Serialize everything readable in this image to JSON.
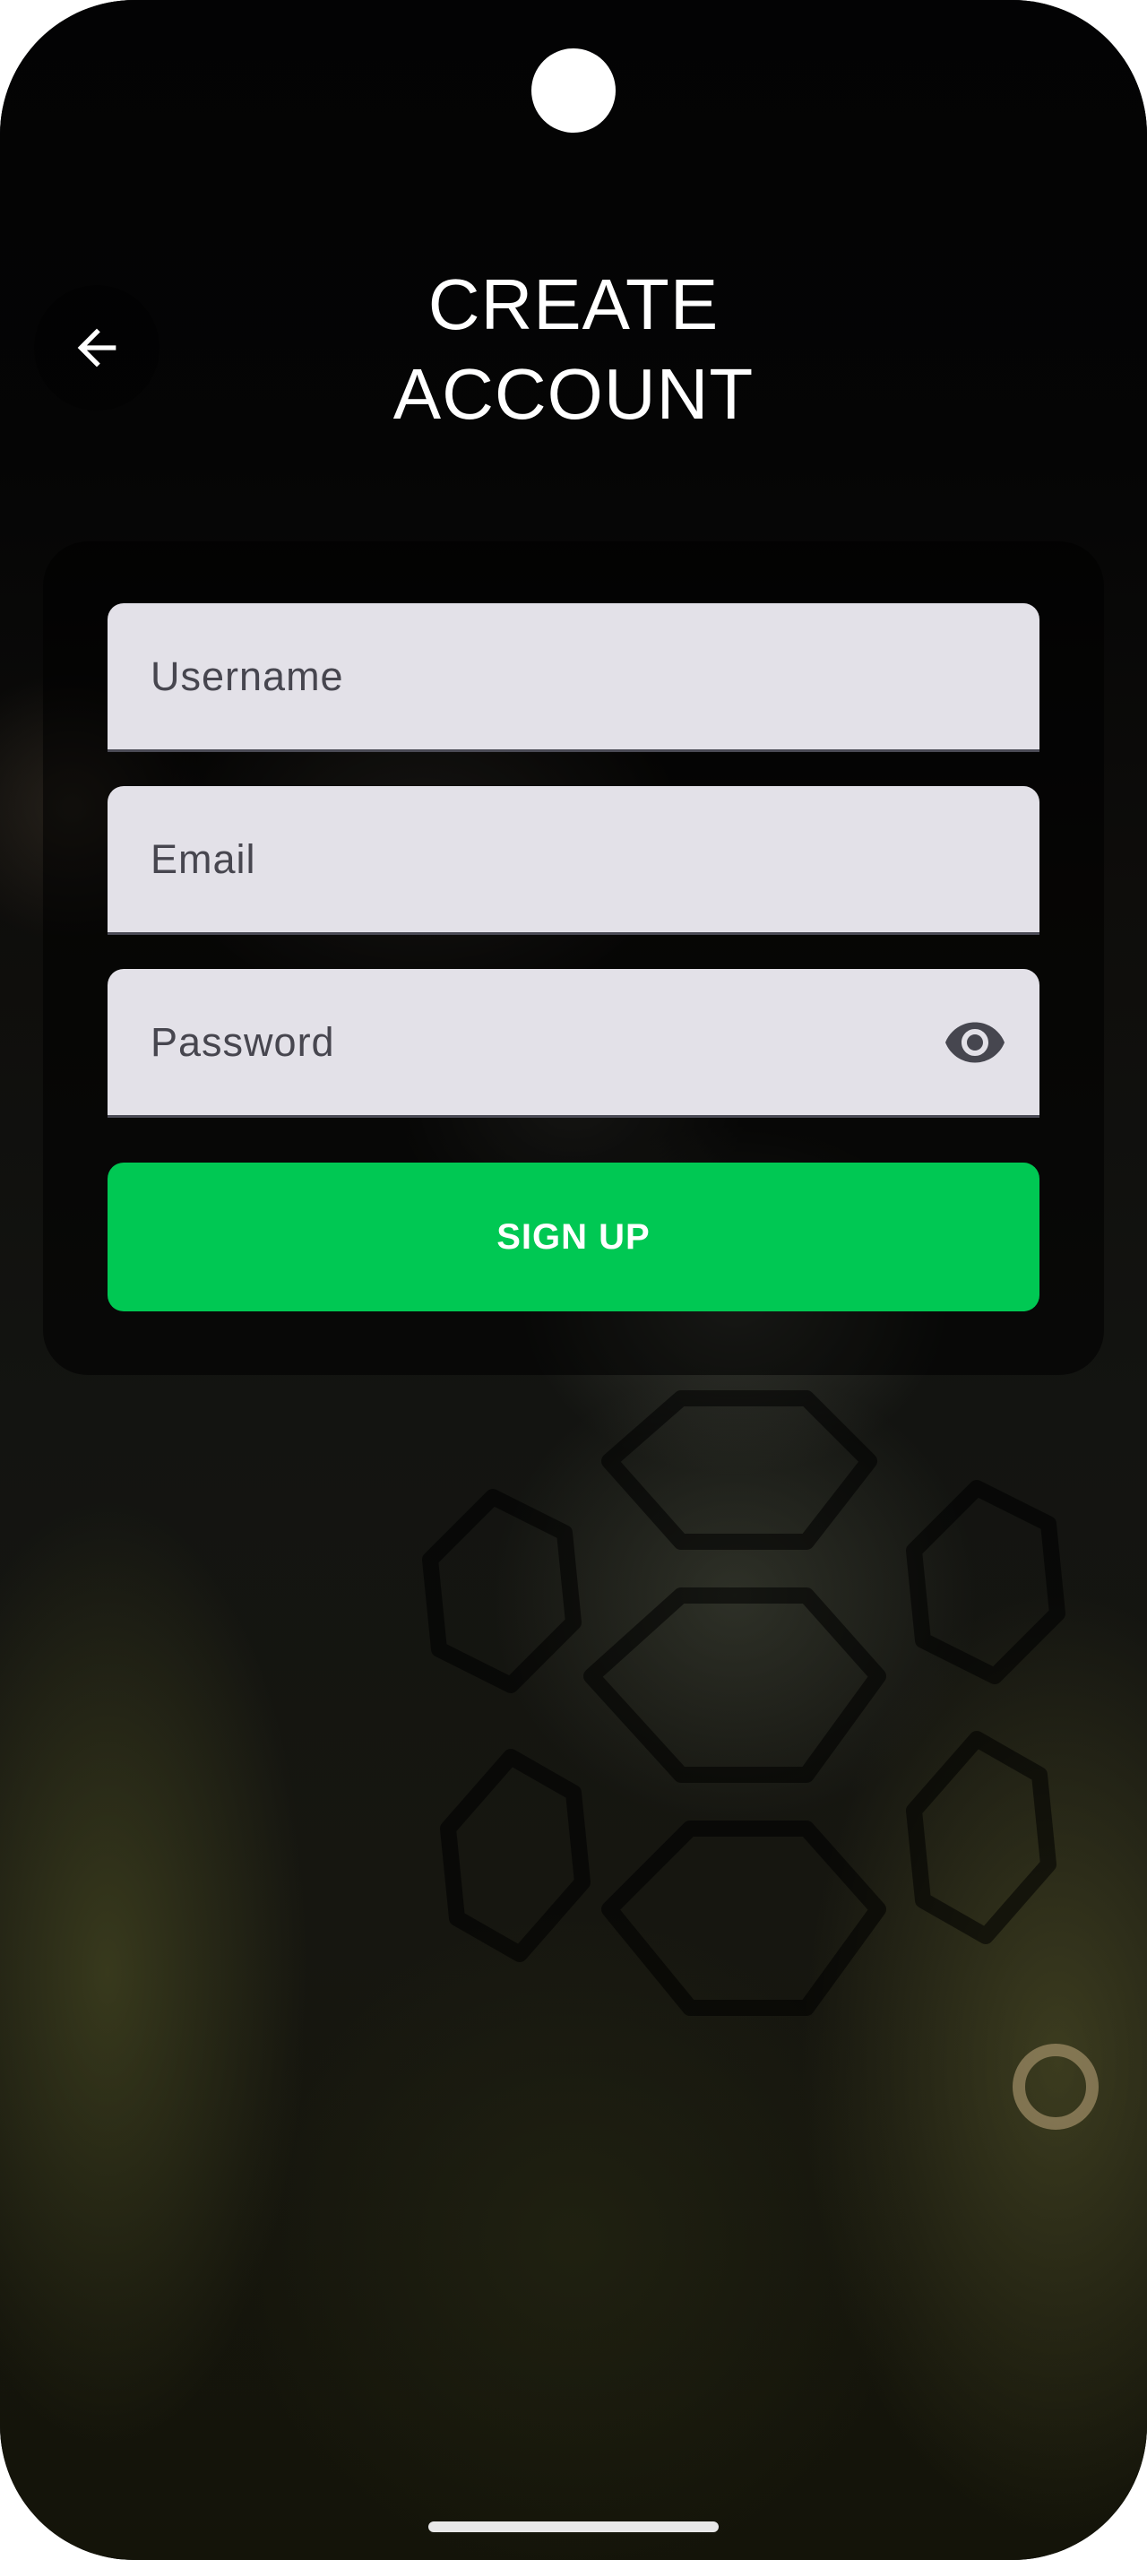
{
  "header": {
    "title": "CREATE\nACCOUNT"
  },
  "back_button": {
    "icon": "arrow-left-icon"
  },
  "form": {
    "username_placeholder": "Username",
    "email_placeholder": "Email",
    "password_placeholder": "Password",
    "password_toggle_icon": "eye-icon",
    "submit_label": "SIGN UP"
  },
  "colors": {
    "accent": "#00c853",
    "field_background": "#e3e1e8",
    "field_text": "#47464f",
    "background": "#030304"
  }
}
